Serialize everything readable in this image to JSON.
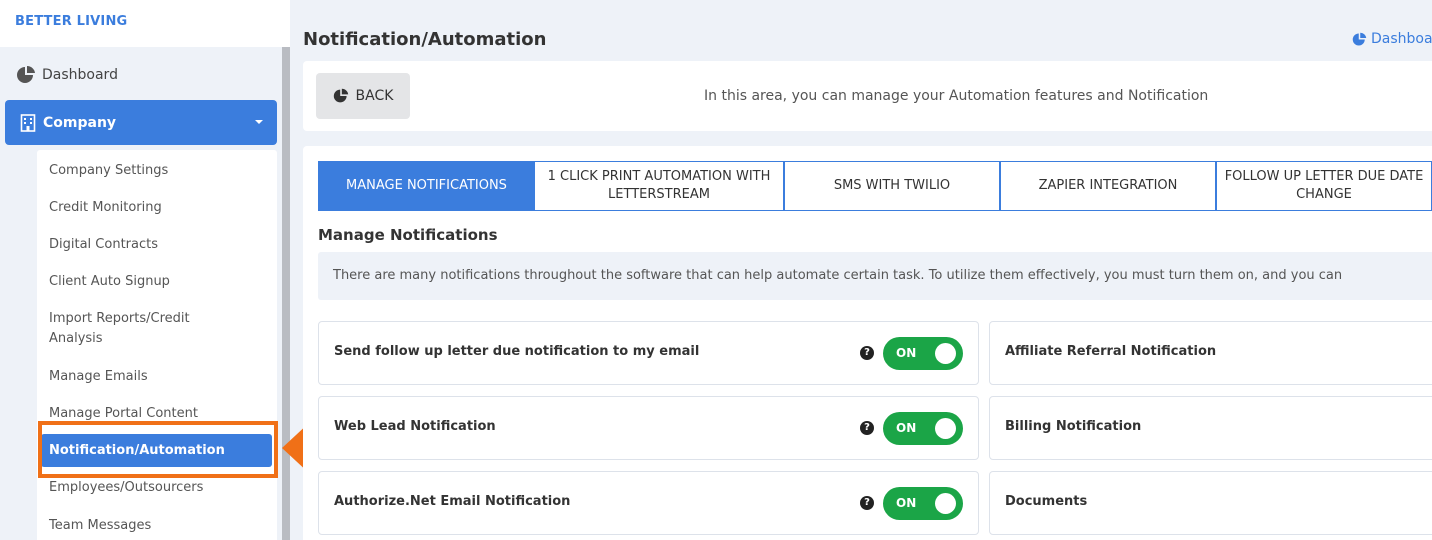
{
  "brand": "BETTER LIVING",
  "sidebar": {
    "dashboard_label": "Dashboard",
    "company_label": "Company",
    "submenu": [
      "Company Settings",
      "Credit Monitoring",
      "Digital Contracts",
      "Client Auto Signup",
      "Import Reports/Credit Analysis",
      "Manage Emails",
      "Manage Portal Content",
      "Notification/Automation",
      "Employees/Outsourcers",
      "Team Messages"
    ],
    "active_item": "Notification/Automation"
  },
  "header": {
    "title": "Notification/Automation",
    "breadcrumb": "Dashboard"
  },
  "top_card": {
    "back_label": "BACK",
    "intro": "In this area, you can manage your Automation features and Notification"
  },
  "tabs": [
    "MANAGE NOTIFICATIONS",
    "1 CLICK PRINT AUTOMATION WITH LETTERSTREAM",
    "SMS WITH TWILIO",
    "ZAPIER INTEGRATION",
    "FOLLOW UP LETTER DUE DATE CHANGE"
  ],
  "section": {
    "title": "Manage Notifications",
    "info": "There are many notifications throughout the software that can help automate certain task. To utilize them effectively, you must turn them on, and you can"
  },
  "notifications_left": [
    {
      "label": "Send follow up letter due notification to my email",
      "state": "ON"
    },
    {
      "label": "Web Lead Notification",
      "state": "ON"
    },
    {
      "label": "Authorize.Net Email Notification",
      "state": "ON"
    }
  ],
  "notifications_right": [
    {
      "label": "Affiliate Referral Notification"
    },
    {
      "label": "Billing Notification"
    },
    {
      "label": "Documents"
    }
  ],
  "colors": {
    "accent": "#3b7ddd",
    "toggle_on": "#1ba547",
    "highlight": "#f07017"
  }
}
